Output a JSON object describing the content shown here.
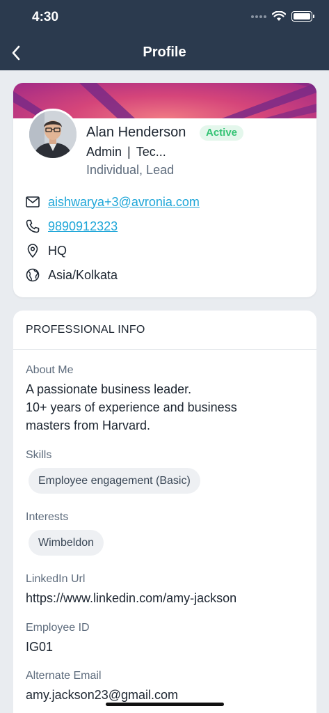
{
  "status_bar": {
    "time": "4:30"
  },
  "header": {
    "title": "Profile"
  },
  "profile": {
    "name": "Alan Henderson",
    "status": "Active",
    "role": "Admin",
    "separator": "|",
    "department": "Tec...",
    "user_type": "Individual, Lead",
    "email": "aishwarya+3@avronia.com",
    "phone": "9890912323",
    "location": "HQ",
    "timezone": "Asia/Kolkata"
  },
  "professional_info": {
    "section_title": "PROFESSIONAL INFO",
    "about_label": "About Me",
    "about_lines": [
      "A passionate business leader.",
      "10+ years of experience and business",
      "masters from Harvard."
    ],
    "skills_label": "Skills",
    "skills": [
      "Employee engagement (Basic)"
    ],
    "interests_label": "Interests",
    "interests": [
      "Wimbeldon"
    ],
    "linkedin_label": "LinkedIn Url",
    "linkedin_value": "https://www.linkedin.com/amy-jackson",
    "employee_id_label": "Employee ID",
    "employee_id_value": "IG01",
    "alt_email_label": "Alternate Email",
    "alt_email_value": "amy.jackson23@gmail.com"
  },
  "colors": {
    "header_bg": "#2b3a4e",
    "active_green": "#34c374",
    "link_blue": "#1ea6d8",
    "banner_pink": "#d5457a"
  },
  "icons": {
    "back": "chevron-left-icon",
    "email": "mail-icon",
    "phone": "phone-icon",
    "location": "map-pin-icon",
    "timezone": "globe-icon"
  }
}
